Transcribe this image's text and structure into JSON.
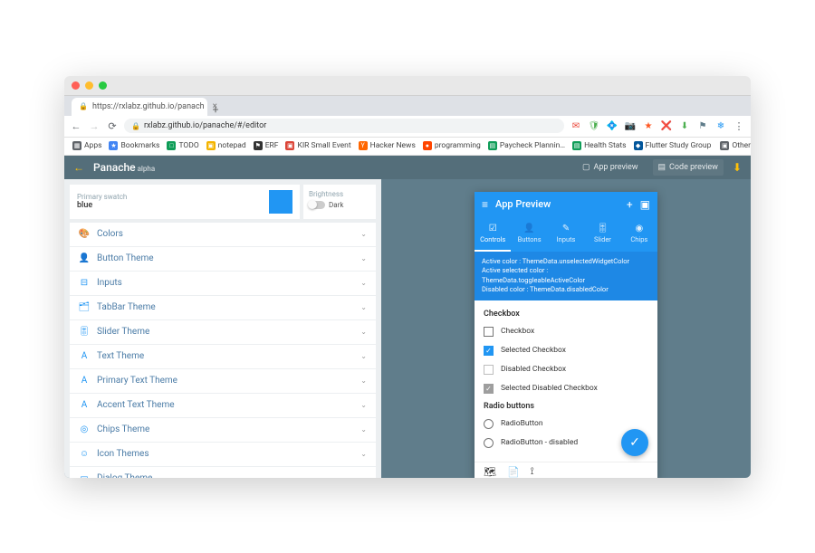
{
  "browser": {
    "tab_title": "https://rxlabz.github.io/panach",
    "url": "rxlabz.github.io/panache/#/editor",
    "toolbar_icons": [
      "🛡",
      "💠",
      "📷",
      "★",
      "❌",
      "⬇",
      "🛡",
      "❄"
    ],
    "bookmarks": [
      {
        "icon_bg": "#5f6368",
        "icon": "▦",
        "label": "Apps"
      },
      {
        "icon_bg": "#4285f4",
        "icon": "★",
        "label": "Bookmarks"
      },
      {
        "icon_bg": "#0f9d58",
        "icon": "□",
        "label": "TODO"
      },
      {
        "icon_bg": "#f4b400",
        "icon": "▣",
        "label": "notepad"
      },
      {
        "icon_bg": "#333",
        "icon": "⚑",
        "label": "ERF"
      },
      {
        "icon_bg": "#db4437",
        "icon": "▣",
        "label": "KIR Small Event"
      },
      {
        "icon_bg": "#ff6600",
        "icon": "Y",
        "label": "Hacker News"
      },
      {
        "icon_bg": "#ff4500",
        "icon": "●",
        "label": "programming"
      },
      {
        "icon_bg": "#0f9d58",
        "icon": "▤",
        "label": "Paycheck Plannin…"
      },
      {
        "icon_bg": "#0f9d58",
        "icon": "▤",
        "label": "Health Stats"
      },
      {
        "icon_bg": "#02569b",
        "icon": "◆",
        "label": "Flutter Study Group"
      }
    ],
    "other_bookmarks": "Other Bookmarks"
  },
  "app": {
    "title": "Panache",
    "sub": "alpha",
    "app_preview": "App preview",
    "code_preview": "Code preview"
  },
  "editor": {
    "swatch_label": "Primary swatch",
    "swatch_value": "blue",
    "brightness_label": "Brightness",
    "brightness_mode": "Dark",
    "panels": [
      {
        "icon": "🎨",
        "label": "Colors"
      },
      {
        "icon": "👤",
        "label": "Button Theme"
      },
      {
        "icon": "⊟",
        "label": "Inputs"
      },
      {
        "icon": "🗂",
        "label": "TabBar Theme"
      },
      {
        "icon": "🎚",
        "label": "Slider Theme"
      },
      {
        "icon": "A",
        "label": "Text Theme"
      },
      {
        "icon": "A",
        "label": "Primary Text Theme"
      },
      {
        "icon": "A",
        "label": "Accent Text Theme"
      },
      {
        "icon": "◎",
        "label": "Chips Theme"
      },
      {
        "icon": "☺",
        "label": "Icon Themes"
      },
      {
        "icon": "▭",
        "label": "Dialog Theme"
      }
    ]
  },
  "preview": {
    "title": "App Preview",
    "tabs": [
      {
        "icon": "☑",
        "label": "Controls"
      },
      {
        "icon": "👤",
        "label": "Buttons"
      },
      {
        "icon": "✎",
        "label": "Inputs"
      },
      {
        "icon": "🎚",
        "label": "Slider"
      },
      {
        "icon": "◉",
        "label": "Chips"
      }
    ],
    "info_lines": [
      "Active color : ThemeData.unselectedWidgetColor",
      "Active selected color :",
      "ThemeData.toggleableActiveColor",
      "Disabled color : ThemeData.disabledColor"
    ],
    "checkbox_heading": "Checkbox",
    "checkboxes": [
      {
        "label": "Checkbox",
        "checked": false,
        "disabled": false
      },
      {
        "label": "Selected Checkbox",
        "checked": true,
        "disabled": false
      },
      {
        "label": "Disabled Checkbox",
        "checked": false,
        "disabled": true
      },
      {
        "label": "Selected Disabled Checkbox",
        "checked": true,
        "disabled": true
      }
    ],
    "radio_heading": "Radio buttons",
    "radios": [
      {
        "label": "RadioButton"
      },
      {
        "label": "RadioButton - disabled"
      }
    ]
  }
}
